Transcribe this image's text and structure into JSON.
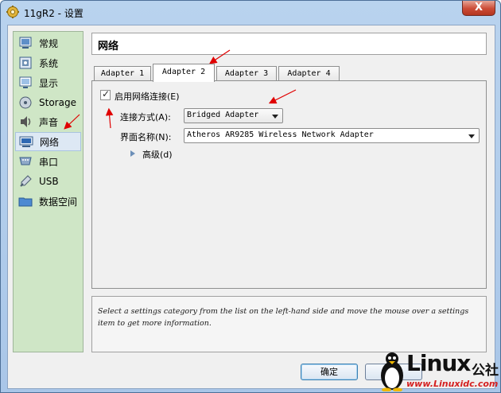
{
  "window": {
    "title": "11gR2 - 设置",
    "close_label": "X"
  },
  "sidebar": {
    "items": [
      {
        "label": "常规",
        "icon": "general-icon"
      },
      {
        "label": "系统",
        "icon": "system-icon"
      },
      {
        "label": "显示",
        "icon": "display-icon"
      },
      {
        "label": "Storage",
        "icon": "storage-icon"
      },
      {
        "label": "声音",
        "icon": "audio-icon"
      },
      {
        "label": "网络",
        "icon": "network-icon",
        "selected": true
      },
      {
        "label": "串口",
        "icon": "serial-port-icon"
      },
      {
        "label": "USB",
        "icon": "usb-icon"
      },
      {
        "label": "数据空间",
        "icon": "shared-folder-icon"
      }
    ]
  },
  "panel": {
    "title": "网络",
    "tabs": [
      {
        "label": "Adapter 1"
      },
      {
        "label": "Adapter 2",
        "active": true
      },
      {
        "label": "Adapter 3"
      },
      {
        "label": "Adapter 4"
      }
    ],
    "enable_label": "启用网络连接(E)",
    "enable_checked": true,
    "attached_label": "连接方式(A):",
    "attached_value": "Bridged Adapter",
    "name_label": "界面名称(N):",
    "name_value": "Atheros AR9285 Wireless Network Adapter",
    "advanced_label": "高级(d)"
  },
  "info_text": "Select a settings category from the list on the left-hand side and move the mouse over a settings item to get more information.",
  "buttons": {
    "ok": "确定"
  },
  "watermark": {
    "brand": "Linux",
    "suffix": "公社",
    "url": "www.Linuxidc.com"
  },
  "colors": {
    "sidebar_bg": "#cfe6c6",
    "annotation_arrow": "#e00000",
    "title_bg": "#b9d3ee"
  }
}
